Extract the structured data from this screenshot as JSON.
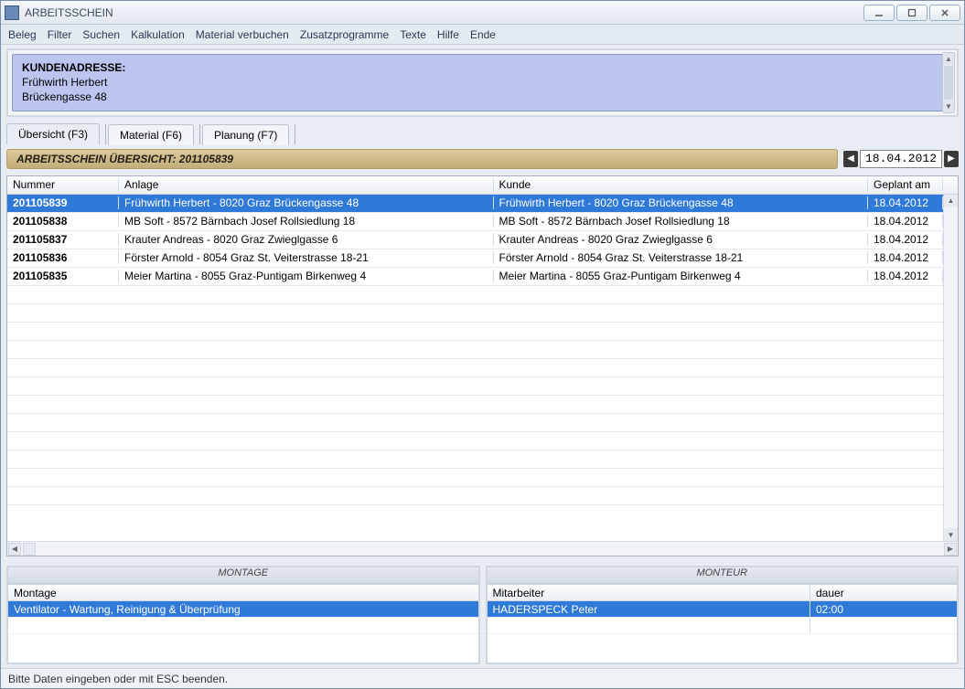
{
  "window": {
    "title": "ARBEITSSCHEIN"
  },
  "menu": {
    "items": [
      "Beleg",
      "Filter",
      "Suchen",
      "Kalkulation",
      "Material verbuchen",
      "Zusatzprogramme",
      "Texte",
      "Hilfe",
      "Ende"
    ]
  },
  "address": {
    "heading": "KUNDENADRESSE:",
    "line1": "Frühwirth Herbert",
    "line2": "Brückengasse 48"
  },
  "tabs": {
    "t0": "Übersicht (F3)",
    "t1": "Material (F6)",
    "t2": "Planung (F7)"
  },
  "overview": {
    "title": "ARBEITSSCHEIN ÜBERSICHT: 201105839",
    "date": "18.04.2012"
  },
  "grid": {
    "headers": {
      "num": "Nummer",
      "anlage": "Anlage",
      "kunde": "Kunde",
      "plan": "Geplant am"
    },
    "rows": [
      {
        "num": "201105839",
        "anlage": "Frühwirth Herbert - 8020 Graz Brückengasse 48",
        "kunde": "Frühwirth Herbert - 8020 Graz Brückengasse 48",
        "plan": "18.04.2012",
        "selected": true
      },
      {
        "num": "201105838",
        "anlage": "MB Soft - 8572 Bärnbach Josef Rollsiedlung 18",
        "kunde": "MB Soft - 8572 Bärnbach Josef Rollsiedlung 18",
        "plan": "18.04.2012"
      },
      {
        "num": "201105837",
        "anlage": "Krauter Andreas - 8020 Graz Zwieglgasse 6",
        "kunde": "Krauter Andreas - 8020 Graz Zwieglgasse 6",
        "plan": "18.04.2012"
      },
      {
        "num": "201105836",
        "anlage": "Förster Arnold - 8054 Graz St. Veiterstrasse 18-21",
        "kunde": "Förster Arnold - 8054 Graz St. Veiterstrasse 18-21",
        "plan": "18.04.2012"
      },
      {
        "num": "201105835",
        "anlage": "Meier Martina - 8055 Graz-Puntigam Birkenweg 4",
        "kunde": "Meier Martina - 8055 Graz-Puntigam Birkenweg 4",
        "plan": "18.04.2012"
      }
    ]
  },
  "montage": {
    "title": "MONTAGE",
    "header": "Montage",
    "row0": "Ventilator - Wartung, Reinigung & Überprüfung"
  },
  "monteur": {
    "title": "MONTEUR",
    "header_a": "Mitarbeiter",
    "header_b": "dauer",
    "row0_a": "HADERSPECK Peter",
    "row0_b": "02:00"
  },
  "status": {
    "text": "Bitte Daten eingeben oder mit ESC beenden."
  }
}
